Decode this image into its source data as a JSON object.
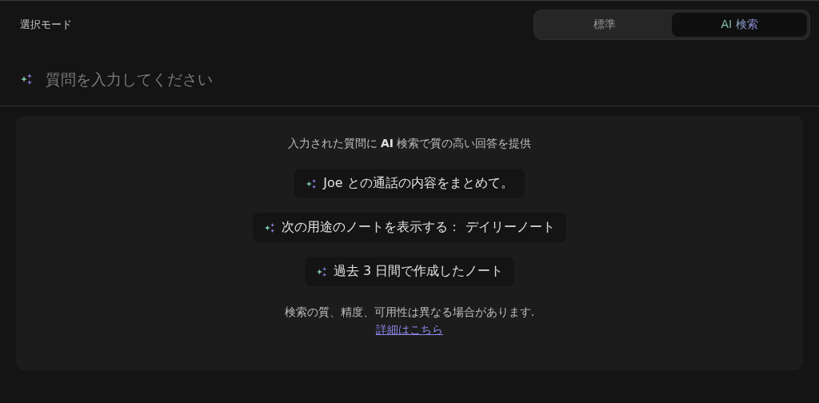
{
  "mode_label": "選択モード",
  "tabs": [
    {
      "label": "標準",
      "selected": false
    },
    {
      "label": "AI 検索",
      "selected": true
    }
  ],
  "search": {
    "placeholder": "質問を入力してください"
  },
  "intro": "入力された質問に **AI** 検索で質の高い回答を提供",
  "suggestions": [
    "Joe との通話の内容をまとめて。",
    "次の用途のノートを表示する： デイリーノート",
    "過去 3 日間で作成したノート"
  ],
  "disclaimer": "検索の質、精度、可用性は異なる場合があります.",
  "link": "詳細はこちら"
}
